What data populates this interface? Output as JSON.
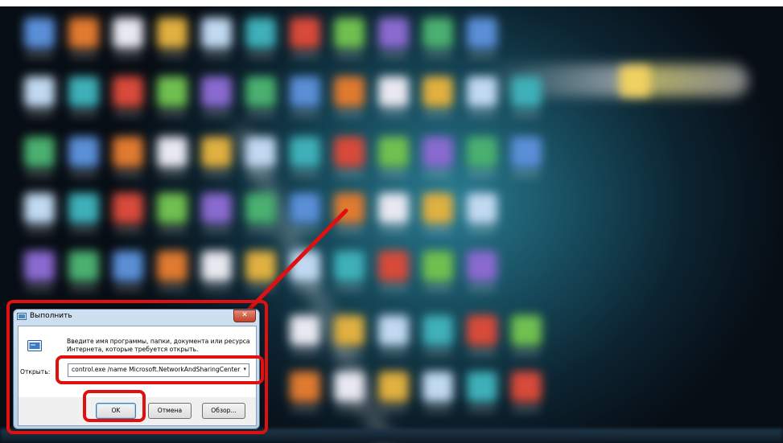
{
  "run_dialog": {
    "title": "Выполнить",
    "close_label": "✕",
    "description": "Введите имя программы, папки, документа или ресурса Интернета, которые требуется открыть.",
    "open_label": "Открыть:",
    "command_value": "control.exe /name Microsoft.NetworkAndSharingCenter",
    "dropdown_glyph": "▾",
    "ok_label": "OK",
    "cancel_label": "Отмена",
    "browse_label": "Обзор..."
  },
  "colors": {
    "highlight": "#e01010",
    "arrow": "#e01010"
  },
  "icons": {
    "title": "run-icon",
    "dialog": "run-icon",
    "close": "close-icon"
  }
}
